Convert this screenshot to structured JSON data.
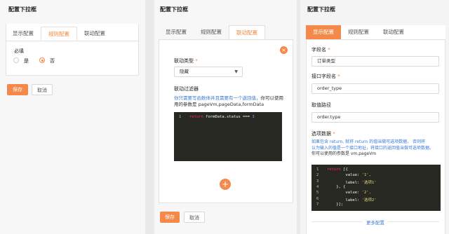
{
  "panel1": {
    "title": "配置下拉框",
    "tabs": [
      "显示配置",
      "规则配置",
      "联动配置"
    ],
    "required_label": "必填",
    "option_yes": "是",
    "option_no": "否",
    "save": "保存",
    "cancel": "取消"
  },
  "panel2": {
    "title": "配置下拉框",
    "tabs": [
      "显示配置",
      "规则配置",
      "联动配置"
    ],
    "link_type_label": "联动类型",
    "link_type_value": "隐藏",
    "filter_label": "联动过滤器",
    "hint_blue": "你只需要写函数体并且需要有一个返回值，",
    "hint_dark": "你可以使用",
    "hint_params": "用的参数是 pageVm,pageData,formData",
    "code": {
      "ln": "1",
      "kw": "return",
      "text": " formData.status === ",
      "num": "3"
    },
    "save": "保存",
    "cancel": "取消"
  },
  "panel3": {
    "title": "配置下拉框",
    "tabs": [
      "显示配置",
      "规则配置",
      "联动配置"
    ],
    "field_label": "字段名",
    "field_value": "订单类型",
    "api_field_label": "接口字段名",
    "api_field_value": "order_type",
    "path_label": "取值路径",
    "path_value": "order.type",
    "options_label": "选项数据",
    "hint_line1": "如果包含 return, 就将 return 的值当做可选项数据， 否则将",
    "hint_line2a": "认为输入的值是一个接口地址，将接口的返回值当做可选项数据。",
    "hint_line3": "你可以使用的参数是 vm,pageVm",
    "code_lines": [
      {
        "ln": "1",
        "kw": "return",
        "text": " [{"
      },
      {
        "ln": "2",
        "kw": "",
        "text": "        value: ",
        "str": "'1',"
      },
      {
        "ln": "3",
        "kw": "",
        "text": "        label: ",
        "str": "'选项1'"
      },
      {
        "ln": "4",
        "kw": "",
        "text": "    }, {"
      },
      {
        "ln": "5",
        "kw": "",
        "text": "        value: ",
        "str": "'2',"
      },
      {
        "ln": "6",
        "kw": "",
        "text": "        label: ",
        "str": "'选项2'"
      },
      {
        "ln": "7",
        "kw": "",
        "text": "    }];"
      }
    ],
    "more": "更多配置"
  },
  "colors": {
    "accent": "#f4894a",
    "link": "#3a7bd5",
    "code_bg": "#272822"
  }
}
